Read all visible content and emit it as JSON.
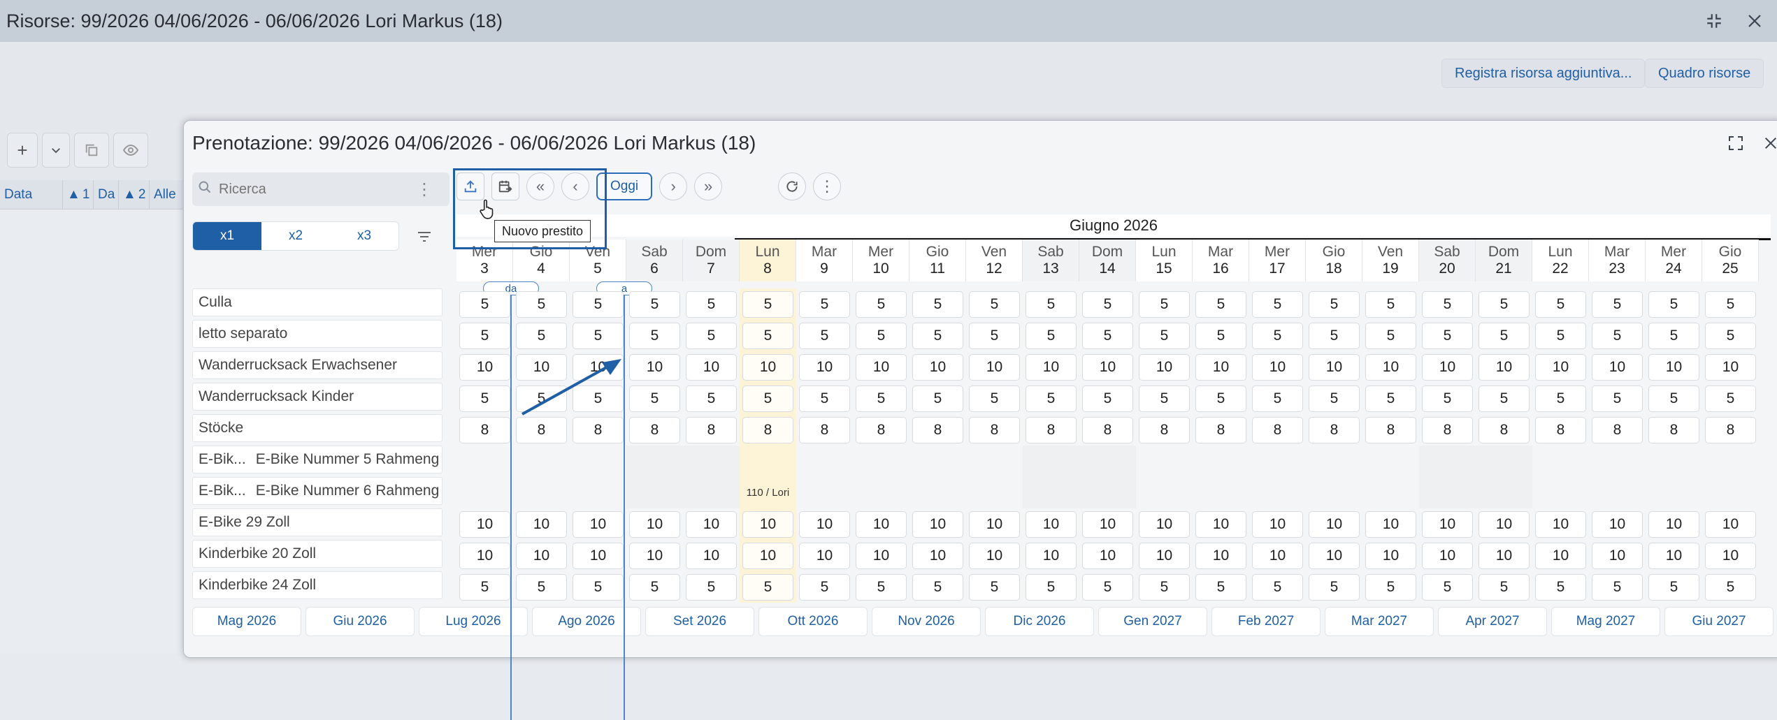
{
  "window": {
    "title": "Risorse: 99/2026 04/06/2026 - 06/06/2026 Lori Markus (18)"
  },
  "header_buttons": {
    "register": "Registra risorsa aggiuntiva...",
    "overview": "Quadro risorse"
  },
  "bg_table": {
    "col_data": "Data",
    "sort1": "1",
    "col_da": "Da",
    "sort2": "2",
    "col_alle": "Alle"
  },
  "modal": {
    "title": "Prenotazione: 99/2026 04/06/2026 - 06/06/2026 Lori Markus (18)"
  },
  "search": {
    "placeholder": "Ricerca"
  },
  "zoom": [
    "x1",
    "x2",
    "x3"
  ],
  "toolbar": {
    "today_label": "Oggi",
    "tooltip": "Nuovo prestito"
  },
  "calendar": {
    "month_label": "Giugno 2026",
    "range_from": "da",
    "range_to": "a",
    "days": [
      {
        "wd": "Mer",
        "d": "3"
      },
      {
        "wd": "Gio",
        "d": "4"
      },
      {
        "wd": "Ven",
        "d": "5"
      },
      {
        "wd": "Sab",
        "d": "6"
      },
      {
        "wd": "Dom",
        "d": "7"
      },
      {
        "wd": "Lun",
        "d": "8"
      },
      {
        "wd": "Mar",
        "d": "9"
      },
      {
        "wd": "Mer",
        "d": "10"
      },
      {
        "wd": "Gio",
        "d": "11"
      },
      {
        "wd": "Ven",
        "d": "12"
      },
      {
        "wd": "Sab",
        "d": "13"
      },
      {
        "wd": "Dom",
        "d": "14"
      },
      {
        "wd": "Lun",
        "d": "15"
      },
      {
        "wd": "Mar",
        "d": "16"
      },
      {
        "wd": "Mer",
        "d": "17"
      },
      {
        "wd": "Gio",
        "d": "18"
      },
      {
        "wd": "Ven",
        "d": "19"
      },
      {
        "wd": "Sab",
        "d": "20"
      },
      {
        "wd": "Dom",
        "d": "21"
      },
      {
        "wd": "Lun",
        "d": "22"
      },
      {
        "wd": "Mar",
        "d": "23"
      },
      {
        "wd": "Mer",
        "d": "24"
      },
      {
        "wd": "Gio",
        "d": "25"
      }
    ]
  },
  "resources": [
    {
      "name": "Culla",
      "value": "5"
    },
    {
      "name": "letto separato",
      "value": "5"
    },
    {
      "name": "Wanderrucksack Erwachsener",
      "value": "10"
    },
    {
      "name": "Wanderrucksack Kinder",
      "value": "5"
    },
    {
      "name": "Stöcke",
      "value": "8"
    },
    {
      "name": "E-Bik...",
      "sub": "E-Bike Nummer 5 Rahmeng",
      "value": ""
    },
    {
      "name": "E-Bik...",
      "sub": "E-Bike Nummer 6 Rahmeng",
      "value": "",
      "booking": "110 / Lori"
    },
    {
      "name": "E-Bike 29 Zoll",
      "value": "10"
    },
    {
      "name": "Kinderbike 20 Zoll",
      "value": "10"
    },
    {
      "name": "Kinderbike 24 Zoll",
      "value": "5"
    }
  ],
  "months_bar": [
    "Mag 2026",
    "Giu 2026",
    "Lug 2026",
    "Ago 2026",
    "Set 2026",
    "Ott 2026",
    "Nov 2026",
    "Dic 2026",
    "Gen 2027",
    "Feb 2027",
    "Mar 2027",
    "Apr 2027",
    "Mag 2027",
    "Giu 2027"
  ]
}
